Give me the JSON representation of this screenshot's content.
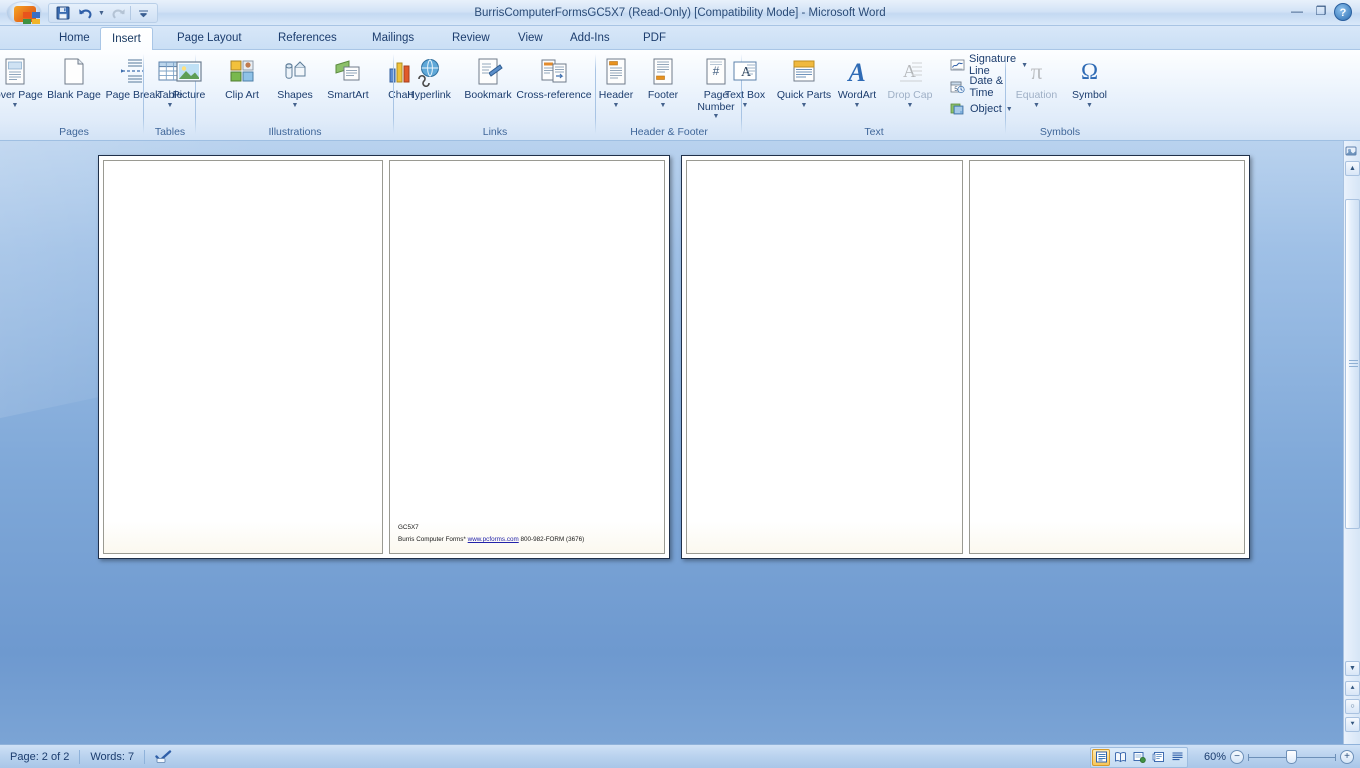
{
  "window": {
    "title": "BurrisComputerFormsGC5X7 (Read-Only) [Compatibility Mode] - Microsoft Word",
    "minimize": "—",
    "restore": "❐",
    "close": "✕",
    "help": "?"
  },
  "quick_access": {
    "save": "save-icon",
    "undo": "undo-icon",
    "redo": "redo-icon",
    "customize": "customize-icon"
  },
  "tabs": [
    {
      "label": "Home",
      "active": false
    },
    {
      "label": "Insert",
      "active": true
    },
    {
      "label": "Page Layout",
      "active": false
    },
    {
      "label": "References",
      "active": false
    },
    {
      "label": "Mailings",
      "active": false
    },
    {
      "label": "Review",
      "active": false
    },
    {
      "label": "View",
      "active": false
    },
    {
      "label": "Add-Ins",
      "active": false
    },
    {
      "label": "PDF",
      "active": false
    }
  ],
  "ribbon": {
    "groups": [
      {
        "name": "Pages",
        "label": "Pages",
        "items": [
          {
            "label": "Cover Page",
            "icon": "cover-page-icon",
            "caret": true,
            "disabled": false
          },
          {
            "label": "Blank Page",
            "icon": "blank-page-icon",
            "caret": false,
            "disabled": false
          },
          {
            "label": "Page Break",
            "icon": "page-break-icon",
            "caret": false,
            "disabled": false
          }
        ]
      },
      {
        "name": "Tables",
        "label": "Tables",
        "items": [
          {
            "label": "Table",
            "icon": "table-icon",
            "caret": true,
            "disabled": false
          }
        ]
      },
      {
        "name": "Illustrations",
        "label": "Illustrations",
        "items": [
          {
            "label": "Picture",
            "icon": "picture-icon",
            "caret": false,
            "disabled": false
          },
          {
            "label": "Clip Art",
            "icon": "clip-art-icon",
            "caret": false,
            "disabled": false
          },
          {
            "label": "Shapes",
            "icon": "shapes-icon",
            "caret": true,
            "disabled": false
          },
          {
            "label": "SmartArt",
            "icon": "smartart-icon",
            "caret": false,
            "disabled": false
          },
          {
            "label": "Chart",
            "icon": "chart-icon",
            "caret": false,
            "disabled": false
          }
        ]
      },
      {
        "name": "Links",
        "label": "Links",
        "items": [
          {
            "label": "Hyperlink",
            "icon": "hyperlink-icon",
            "caret": false,
            "disabled": false
          },
          {
            "label": "Bookmark",
            "icon": "bookmark-icon",
            "caret": false,
            "disabled": false
          },
          {
            "label": "Cross-reference",
            "icon": "cross-reference-icon",
            "caret": false,
            "disabled": false
          }
        ]
      },
      {
        "name": "HeaderFooter",
        "label": "Header & Footer",
        "items": [
          {
            "label": "Header",
            "icon": "header-icon",
            "caret": true,
            "disabled": false
          },
          {
            "label": "Footer",
            "icon": "footer-icon",
            "caret": true,
            "disabled": false
          },
          {
            "label": "Page Number",
            "icon": "page-number-icon",
            "caret": true,
            "disabled": false
          }
        ]
      },
      {
        "name": "Text",
        "label": "Text",
        "items": [
          {
            "label": "Text Box",
            "icon": "text-box-icon",
            "caret": true,
            "disabled": false
          },
          {
            "label": "Quick Parts",
            "icon": "quick-parts-icon",
            "caret": true,
            "disabled": false
          },
          {
            "label": "WordArt",
            "icon": "wordart-icon",
            "caret": true,
            "disabled": false
          },
          {
            "label": "Drop Cap",
            "icon": "drop-cap-icon",
            "caret": true,
            "disabled": true
          }
        ],
        "small_items": [
          {
            "label": "Signature Line",
            "icon": "signature-line-icon",
            "caret": true
          },
          {
            "label": "Date & Time",
            "icon": "date-time-icon",
            "caret": false
          },
          {
            "label": "Object",
            "icon": "object-icon",
            "caret": true
          }
        ]
      },
      {
        "name": "Symbols",
        "label": "Symbols",
        "items": [
          {
            "label": "Equation",
            "icon": "equation-icon",
            "glyph": "π",
            "caret": true,
            "disabled": true
          },
          {
            "label": "Symbol",
            "icon": "symbol-icon",
            "glyph": "Ω",
            "caret": true,
            "disabled": false
          }
        ]
      }
    ]
  },
  "document": {
    "spreads": [
      {
        "pages": [
          {
            "text_lines": []
          },
          {
            "text_lines": [
              "GC5X7"
            ],
            "footer_prefix": "Burris Computer Forms*",
            "footer_link": "www.pcforms.com",
            "footer_suffix": "800-982-FORM (3676)"
          }
        ]
      },
      {
        "pages": [
          {
            "text_lines": []
          },
          {
            "text_lines": []
          }
        ]
      }
    ]
  },
  "status_bar": {
    "page": "Page: 2 of 2",
    "words": "Words: 7",
    "proofing_icon": "proofing-errors-icon",
    "views": [
      {
        "name": "print-layout",
        "active": true
      },
      {
        "name": "full-screen-reading",
        "active": false
      },
      {
        "name": "web-layout",
        "active": false
      },
      {
        "name": "outline",
        "active": false
      },
      {
        "name": "draft",
        "active": false
      }
    ],
    "zoom": "60%",
    "zoom_out": "−",
    "zoom_in": "+"
  },
  "colors": {
    "accent": "#1c3d6e",
    "workspace_top": "#b9d2ee",
    "workspace_bottom": "#7ba4d5",
    "tab_active_bg": "#ffffff",
    "highlight": "#f7c75b"
  }
}
